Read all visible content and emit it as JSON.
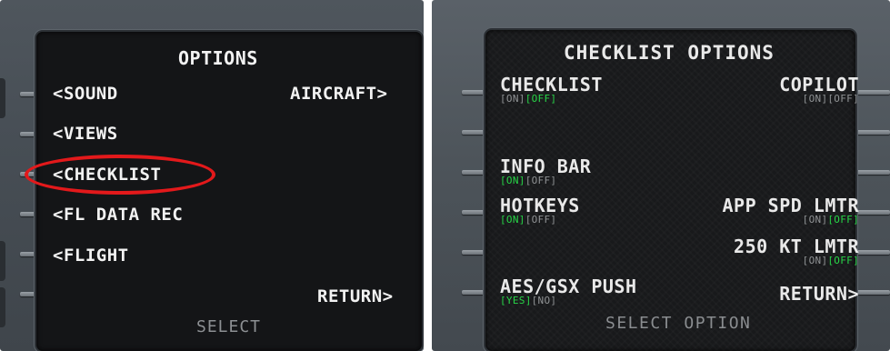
{
  "options_page": {
    "title": "OPTIONS",
    "left": [
      "<SOUND",
      "<VIEWS",
      "<CHECKLIST",
      "<FL DATA REC",
      "<FLIGHT"
    ],
    "aircraft": "AIRCRAFT>",
    "return": "RETURN>",
    "footer": "SELECT",
    "highlight_color": "#e3191b"
  },
  "checklist_page": {
    "title": "CHECKLIST OPTIONS",
    "checklist": {
      "label": "CHECKLIST",
      "a": "[ON]",
      "b": "[OFF]",
      "active": "b"
    },
    "copilot": {
      "label": "COPILOT",
      "a": "[ON]",
      "b": "[OFF]",
      "active": "none"
    },
    "infobar": {
      "label": "INFO BAR",
      "a": "[ON]",
      "b": "[OFF]",
      "active": "a"
    },
    "hotkeys": {
      "label": "HOTKEYS",
      "a": "[ON]",
      "b": "[OFF]",
      "active": "a"
    },
    "app_spd": {
      "label": "APP SPD LMTR",
      "a": "[ON]",
      "b": "[OFF]",
      "active": "b"
    },
    "kt250": {
      "label": "250 KT LMTR",
      "a": "[ON]",
      "b": "[OFF]",
      "active": "b"
    },
    "aes": {
      "label": "AES/GSX PUSH",
      "a": "[YES]",
      "b": "[NO]",
      "active": "a"
    },
    "return": "RETURN>",
    "footer": "SELECT OPTION",
    "active_color": "#27d447",
    "inactive_color": "#8f9294"
  }
}
